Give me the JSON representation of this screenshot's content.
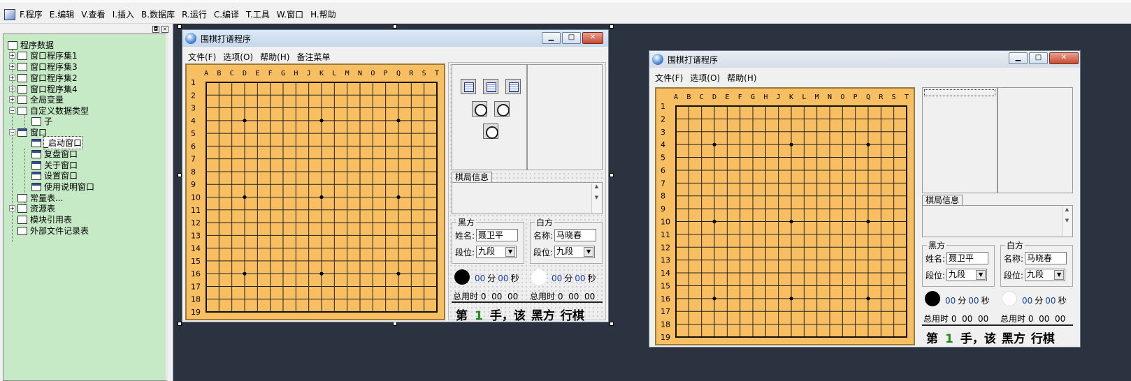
{
  "menu": {
    "items": [
      "F.程序",
      "E.编辑",
      "V.查看",
      "I.插入",
      "B.数据库",
      "R.运行",
      "C.编译",
      "T.工具",
      "W.窗口",
      "H.帮助"
    ]
  },
  "panel": {
    "btn1": "◘",
    "btn2": "×"
  },
  "tree": {
    "root": "程序数据",
    "nodes": [
      {
        "label": "窗口程序集1",
        "exp": "+"
      },
      {
        "label": "窗口程序集3",
        "exp": "+"
      },
      {
        "label": "窗口程序集2",
        "exp": "+"
      },
      {
        "label": "窗口程序集4",
        "exp": "+"
      },
      {
        "label": "全局变量",
        "exp": "+"
      },
      {
        "label": "自定义数据类型",
        "exp": "−"
      },
      {
        "label": "子"
      },
      {
        "label": "窗口",
        "exp": "−"
      },
      {
        "label": "_启动窗口"
      },
      {
        "label": "复盘窗口"
      },
      {
        "label": "关于窗口"
      },
      {
        "label": "设置窗口"
      },
      {
        "label": "使用说明窗口"
      },
      {
        "label": "常量表..."
      },
      {
        "label": "资源表",
        "exp": "+"
      },
      {
        "label": "模块引用表"
      },
      {
        "label": "外部文件记录表"
      }
    ]
  },
  "designer": {
    "title": "围棋打谱程序",
    "menu": [
      "文件(F)",
      "选项(O)",
      "帮助(H)",
      "备注菜单"
    ],
    "min": "▁",
    "max": "□",
    "close": "✕"
  },
  "preview": {
    "title": "围棋打谱程序",
    "menu": [
      "文件(F)",
      "选项(O)",
      "帮助(H)"
    ],
    "min": "▁",
    "max": "□",
    "close": "✕"
  },
  "board": {
    "cols": [
      "A",
      "B",
      "C",
      "D",
      "E",
      "F",
      "G",
      "H",
      "J",
      "K",
      "L",
      "M",
      "N",
      "O",
      "P",
      "Q",
      "R",
      "S",
      "T"
    ],
    "rows": [
      "1",
      "2",
      "3",
      "4",
      "5",
      "6",
      "7",
      "8",
      "9",
      "10",
      "11",
      "12",
      "13",
      "14",
      "15",
      "16",
      "17",
      "18",
      "19"
    ],
    "color": "#f8bf62"
  },
  "info": {
    "tab": "棋局信息",
    "black_group": "黑方",
    "white_group": "白方",
    "black_name_label": "姓名:",
    "black_name": "聂卫平",
    "white_name_label": "名称:",
    "white_name": "马晓春",
    "rank_label": "段位:",
    "black_rank": "九段",
    "white_rank": "九段",
    "min_val": "00",
    "min_unit": "分",
    "sec_val": "00",
    "sec_unit": "秒",
    "total_label": "总用时",
    "total_h": "0",
    "total_m": "00",
    "total_s": "00",
    "status_pre": "第",
    "move": "1",
    "status_mid": "手，该",
    "side": "黑方",
    "status_post": "行棋"
  }
}
